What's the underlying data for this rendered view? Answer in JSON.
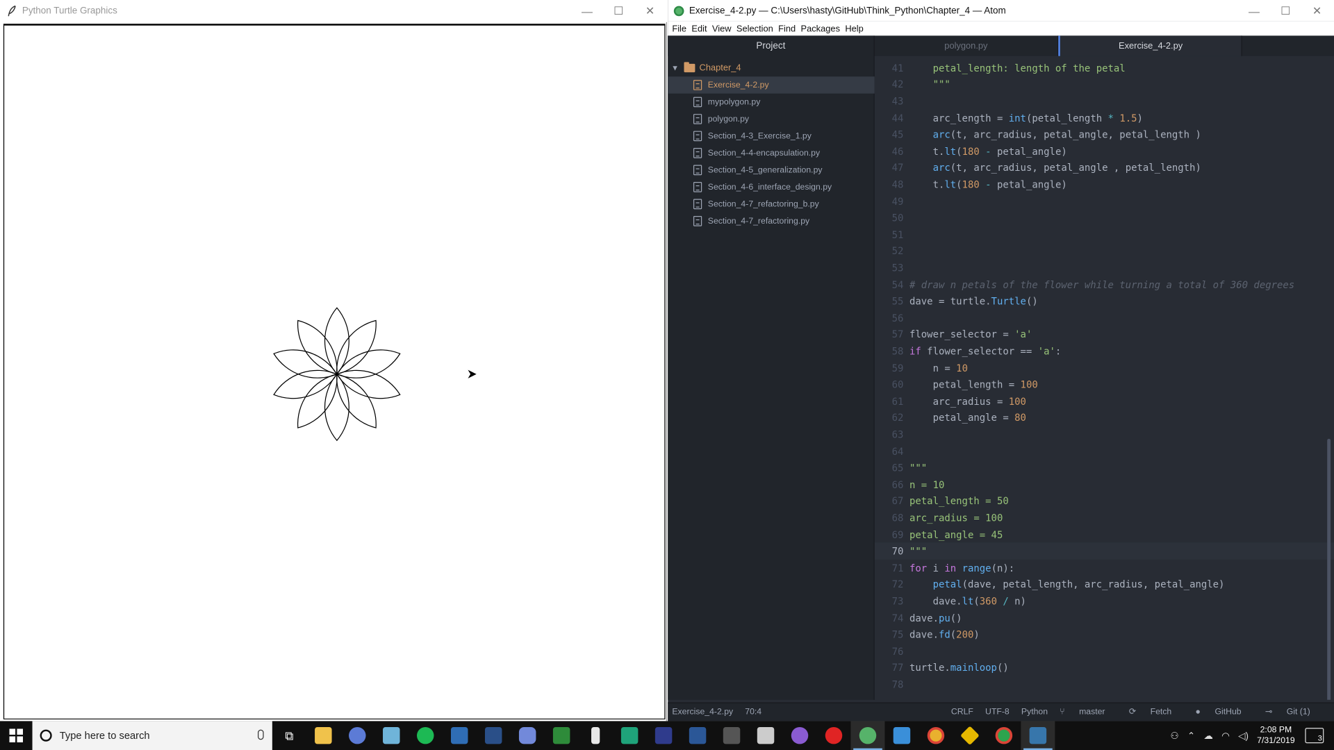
{
  "turtle": {
    "title": "Python Turtle Graphics",
    "controls": {
      "minimize": "—",
      "maximize": "☐",
      "close": "✕"
    },
    "drawing": {
      "petals": 10,
      "petal_angle": 80,
      "arc_radius": 100,
      "petal_length": 100
    }
  },
  "atom": {
    "title": "Exercise_4-2.py — C:\\Users\\hasty\\GitHub\\Think_Python\\Chapter_4 — Atom",
    "controls": {
      "minimize": "—",
      "maximize": "☐",
      "close": "✕"
    },
    "menu": [
      "File",
      "Edit",
      "View",
      "Selection",
      "Find",
      "Packages",
      "Help"
    ],
    "project_header": "Project",
    "tabs": [
      {
        "label": "polygon.py",
        "active": false
      },
      {
        "label": "Exercise_4-2.py",
        "active": true
      }
    ],
    "tree": {
      "root": "Chapter_4",
      "files": [
        "Exercise_4-2.py",
        "mypolygon.py",
        "polygon.py",
        "Section_4-3_Exercise_1.py",
        "Section_4-4-encapsulation.py",
        "Section_4-5_generalization.py",
        "Section_4-6_interface_design.py",
        "Section_4-7_refactoring_b.py",
        "Section_4-7_refactoring.py"
      ],
      "selected": "Exercise_4-2.py"
    },
    "editor": {
      "current_line": 70,
      "lines": [
        {
          "n": 41,
          "t": "    petal_length: length of the petal"
        },
        {
          "n": 42,
          "t": "    \"\"\""
        },
        {
          "n": 43,
          "t": ""
        },
        {
          "n": 44,
          "t": "    arc_length = int(petal_length * 1.5)"
        },
        {
          "n": 45,
          "t": "    arc(t, arc_radius, petal_angle, petal_length )"
        },
        {
          "n": 46,
          "t": "    t.lt(180 - petal_angle)"
        },
        {
          "n": 47,
          "t": "    arc(t, arc_radius, petal_angle , petal_length)"
        },
        {
          "n": 48,
          "t": "    t.lt(180 - petal_angle)"
        },
        {
          "n": 49,
          "t": ""
        },
        {
          "n": 50,
          "t": ""
        },
        {
          "n": 51,
          "t": ""
        },
        {
          "n": 52,
          "t": ""
        },
        {
          "n": 53,
          "t": ""
        },
        {
          "n": 54,
          "t": "# draw n petals of the flower while turning a total of 360 degrees"
        },
        {
          "n": 55,
          "t": "dave = turtle.Turtle()"
        },
        {
          "n": 56,
          "t": ""
        },
        {
          "n": 57,
          "t": "flower_selector = 'a'"
        },
        {
          "n": 58,
          "t": "if flower_selector == 'a':"
        },
        {
          "n": 59,
          "t": "    n = 10"
        },
        {
          "n": 60,
          "t": "    petal_length = 100"
        },
        {
          "n": 61,
          "t": "    arc_radius = 100"
        },
        {
          "n": 62,
          "t": "    petal_angle = 80"
        },
        {
          "n": 63,
          "t": ""
        },
        {
          "n": 64,
          "t": ""
        },
        {
          "n": 65,
          "t": "\"\"\""
        },
        {
          "n": 66,
          "t": "n = 10"
        },
        {
          "n": 67,
          "t": "petal_length = 50"
        },
        {
          "n": 68,
          "t": "arc_radius = 100"
        },
        {
          "n": 69,
          "t": "petal_angle = 45"
        },
        {
          "n": 70,
          "t": "\"\"\""
        },
        {
          "n": 71,
          "t": "for i in range(n):"
        },
        {
          "n": 72,
          "t": "    petal(dave, petal_length, arc_radius, petal_angle)"
        },
        {
          "n": 73,
          "t": "    dave.lt(360 / n)"
        },
        {
          "n": 74,
          "t": "dave.pu()"
        },
        {
          "n": 75,
          "t": "dave.fd(200)"
        },
        {
          "n": 76,
          "t": ""
        },
        {
          "n": 77,
          "t": "turtle.mainloop()"
        },
        {
          "n": 78,
          "t": ""
        }
      ]
    },
    "status": {
      "file": "Exercise_4-2.py",
      "cursor": "70:4",
      "line_ending": "CRLF",
      "encoding": "UTF-8",
      "grammar": "Python",
      "branch": "master",
      "fetch": "Fetch",
      "github": "GitHub",
      "git": "Git (1)"
    }
  },
  "taskbar": {
    "search_placeholder": "Type here to search",
    "time": "2:08 PM",
    "date": "7/31/2019",
    "notifications": "3"
  }
}
